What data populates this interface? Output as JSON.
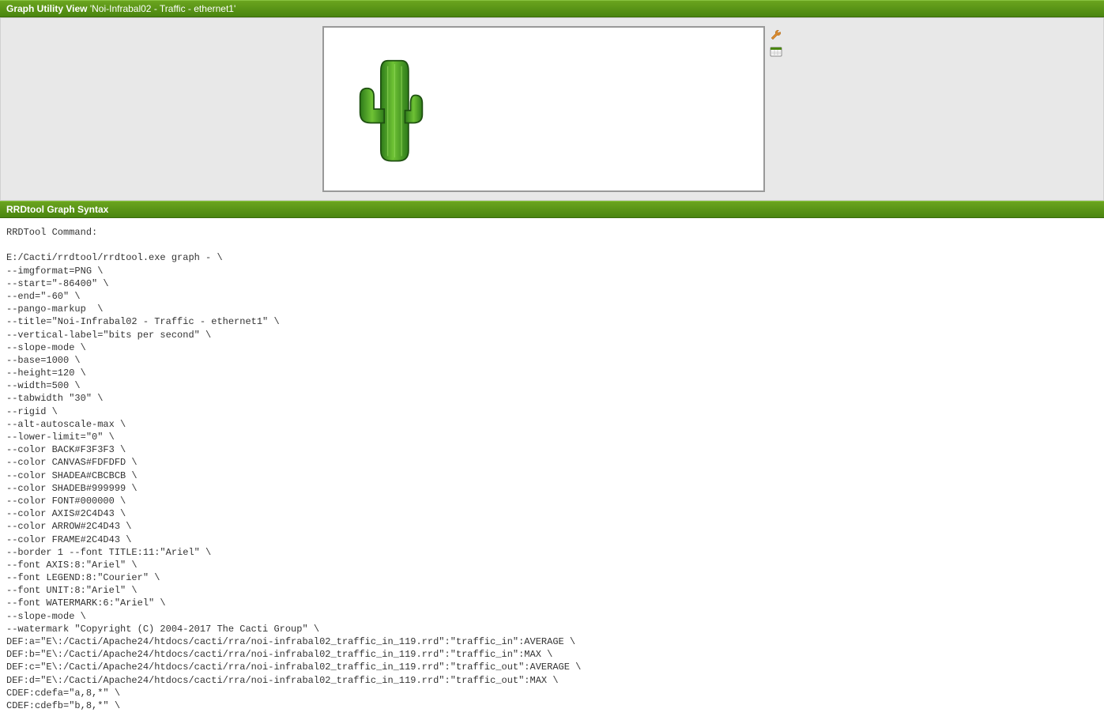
{
  "header": {
    "title_label": "Graph Utility View",
    "title_name": "'Noi-Infrabal02 - Traffic - ethernet1'"
  },
  "icons": {
    "wrench": "wrench-icon",
    "csv": "csv-export-icon"
  },
  "section": {
    "title": "RRDtool Graph Syntax"
  },
  "command": {
    "label": "RRDTool Command:",
    "text": "E:/Cacti/rrdtool/rrdtool.exe graph - \\\n--imgformat=PNG \\\n--start=\"-86400\" \\\n--end=\"-60\" \\\n--pango-markup  \\\n--title=\"Noi-Infrabal02 - Traffic - ethernet1\" \\\n--vertical-label=\"bits per second\" \\\n--slope-mode \\\n--base=1000 \\\n--height=120 \\\n--width=500 \\\n--tabwidth \"30\" \\\n--rigid \\\n--alt-autoscale-max \\\n--lower-limit=\"0\" \\\n--color BACK#F3F3F3 \\\n--color CANVAS#FDFDFD \\\n--color SHADEA#CBCBCB \\\n--color SHADEB#999999 \\\n--color FONT#000000 \\\n--color AXIS#2C4D43 \\\n--color ARROW#2C4D43 \\\n--color FRAME#2C4D43 \\\n--border 1 --font TITLE:11:\"Ariel\" \\\n--font AXIS:8:\"Ariel\" \\\n--font LEGEND:8:\"Courier\" \\\n--font UNIT:8:\"Ariel\" \\\n--font WATERMARK:6:\"Ariel\" \\\n--slope-mode \\\n--watermark \"Copyright (C) 2004-2017 The Cacti Group\" \\\nDEF:a=\"E\\:/Cacti/Apache24/htdocs/cacti/rra/noi-infrabal02_traffic_in_119.rrd\":\"traffic_in\":AVERAGE \\\nDEF:b=\"E\\:/Cacti/Apache24/htdocs/cacti/rra/noi-infrabal02_traffic_in_119.rrd\":\"traffic_in\":MAX \\\nDEF:c=\"E\\:/Cacti/Apache24/htdocs/cacti/rra/noi-infrabal02_traffic_in_119.rrd\":\"traffic_out\":AVERAGE \\\nDEF:d=\"E\\:/Cacti/Apache24/htdocs/cacti/rra/noi-infrabal02_traffic_in_119.rrd\":\"traffic_out\":MAX \\\nCDEF:cdefa=\"a,8,*\" \\\nCDEF:cdefb=\"b,8,*\" \\"
  }
}
